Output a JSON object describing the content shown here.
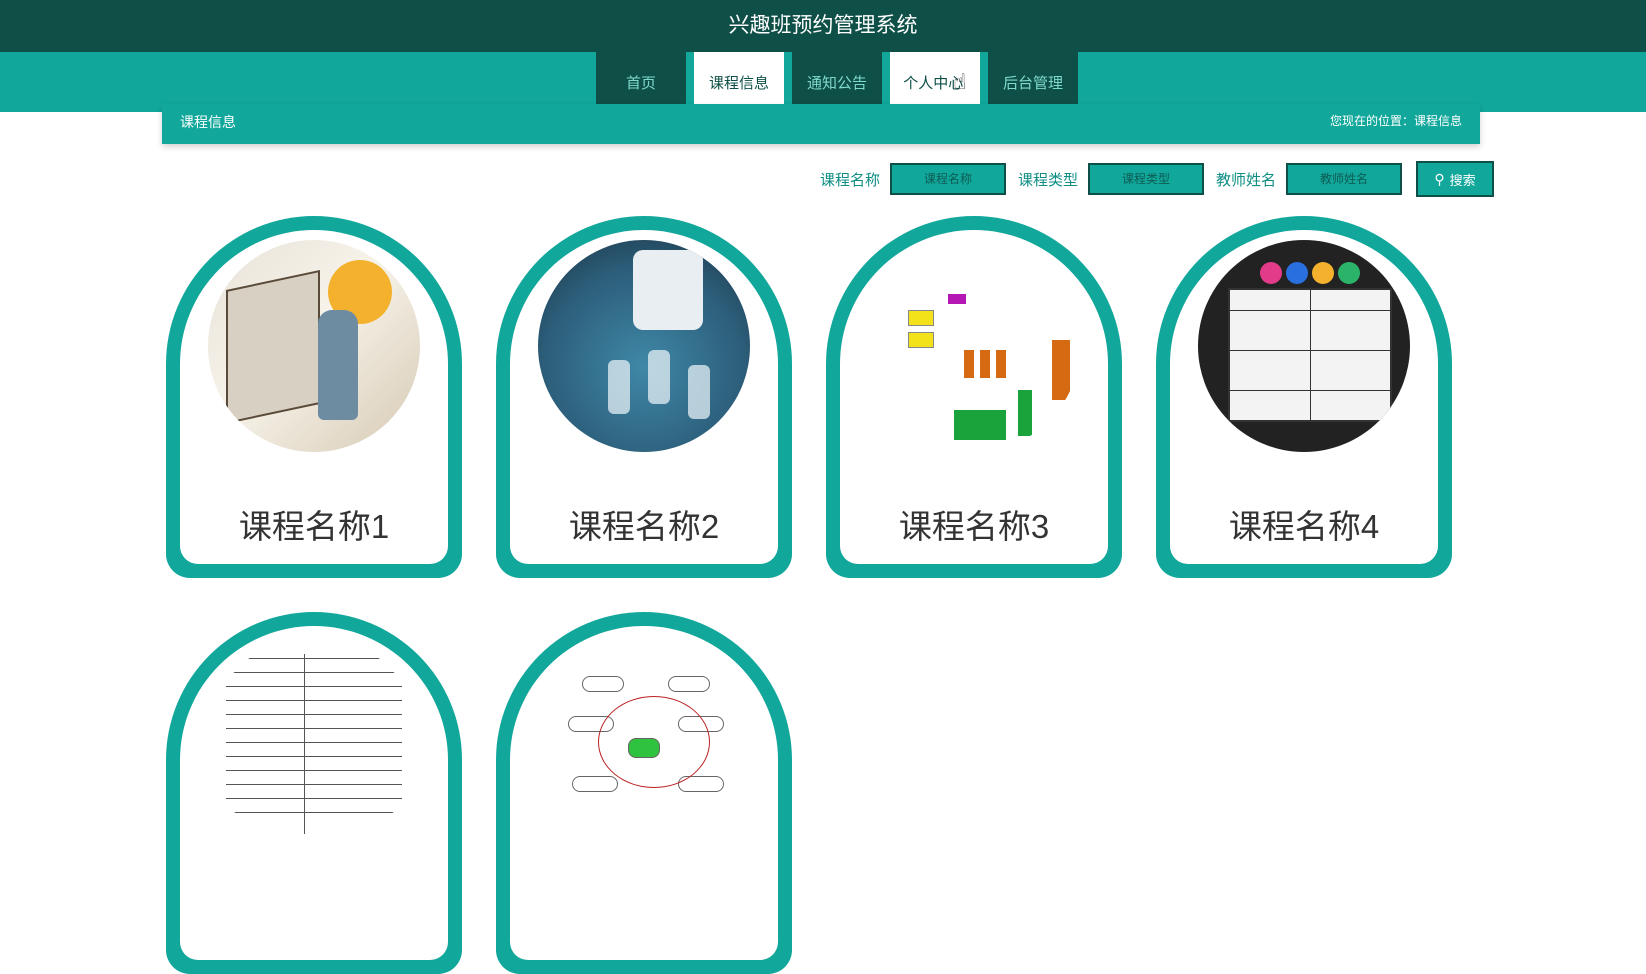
{
  "header": {
    "title": "兴趣班预约管理系统"
  },
  "nav": {
    "items": [
      {
        "label": "首页"
      },
      {
        "label": "课程信息"
      },
      {
        "label": "通知公告"
      },
      {
        "label": "个人中心"
      },
      {
        "label": "后台管理"
      }
    ],
    "active": "课程信息"
  },
  "breadcrumb": {
    "section": "课程信息",
    "location": "您现在的位置：课程信息"
  },
  "search": {
    "course_name_label": "课程名称",
    "course_name_placeholder": "课程名称",
    "course_type_label": "课程类型",
    "course_type_placeholder": "课程类型",
    "teacher_label": "教师姓名",
    "teacher_placeholder": "教师姓名",
    "button_label": "搜索"
  },
  "courses": [
    {
      "name": "课程名称1"
    },
    {
      "name": "课程名称2"
    },
    {
      "name": "课程名称3"
    },
    {
      "name": "课程名称4"
    },
    {
      "name": ""
    },
    {
      "name": ""
    }
  ],
  "colors": {
    "dark_teal": "#0e4f47",
    "teal": "#11a79b"
  }
}
